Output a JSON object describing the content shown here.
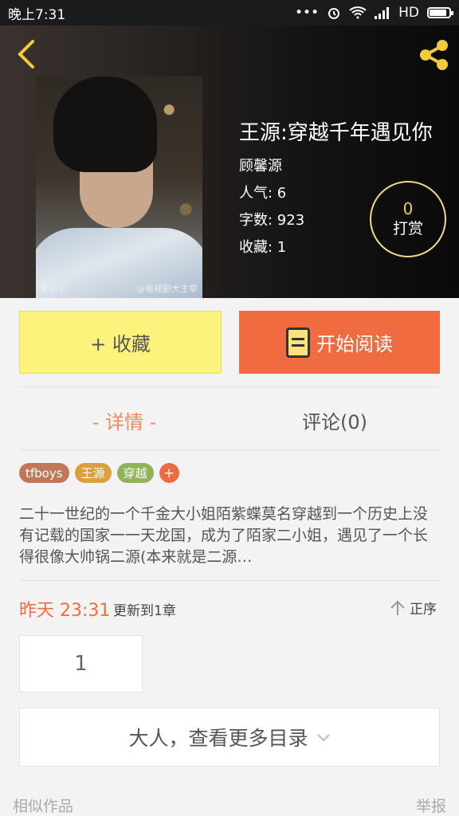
{
  "status_bar": {
    "time": "晚上7:31",
    "network": "HD"
  },
  "header": {
    "cover_watermark_left": "爱奇艺",
    "cover_watermark_right": "@电视剧大主宰"
  },
  "book": {
    "title": "王源:穿越千年遇见你",
    "author": "顾馨源",
    "popularity": "人气: 6",
    "word_count": "字数: 923",
    "favorites": "收藏: 1"
  },
  "tip": {
    "count": "0",
    "label": "打赏"
  },
  "actions": {
    "favorite_label": "+ 收藏",
    "read_label": "开始阅读"
  },
  "tabs": {
    "detail": "- 详情 -",
    "comments": "评论(0)"
  },
  "tags": [
    {
      "label": "tfboys",
      "color": "#c0785a"
    },
    {
      "label": "王源",
      "color": "#d9a03c"
    },
    {
      "label": "穿越",
      "color": "#8fb25a"
    }
  ],
  "tag_add_label": "+",
  "synopsis": "二十一世纪的一个千金大小姐陌紫蝶莫名穿越到一个历史上没有记载的国家一一天龙国，成为了陌家二小姐，遇见了一个长得很像大帅锅二源(本来就是二源…",
  "update": {
    "time": "昨天 23:31",
    "text": "更新到1章",
    "sort_label": "正序"
  },
  "chapters": [
    "1"
  ],
  "more_catalog": "大人，查看更多目录",
  "footer": {
    "similar": "相似作品",
    "report": "举报"
  },
  "colors": {
    "accent_orange": "#f06b40",
    "favorite_yellow": "#fbf37c",
    "tip_gold": "#f3c93e"
  }
}
